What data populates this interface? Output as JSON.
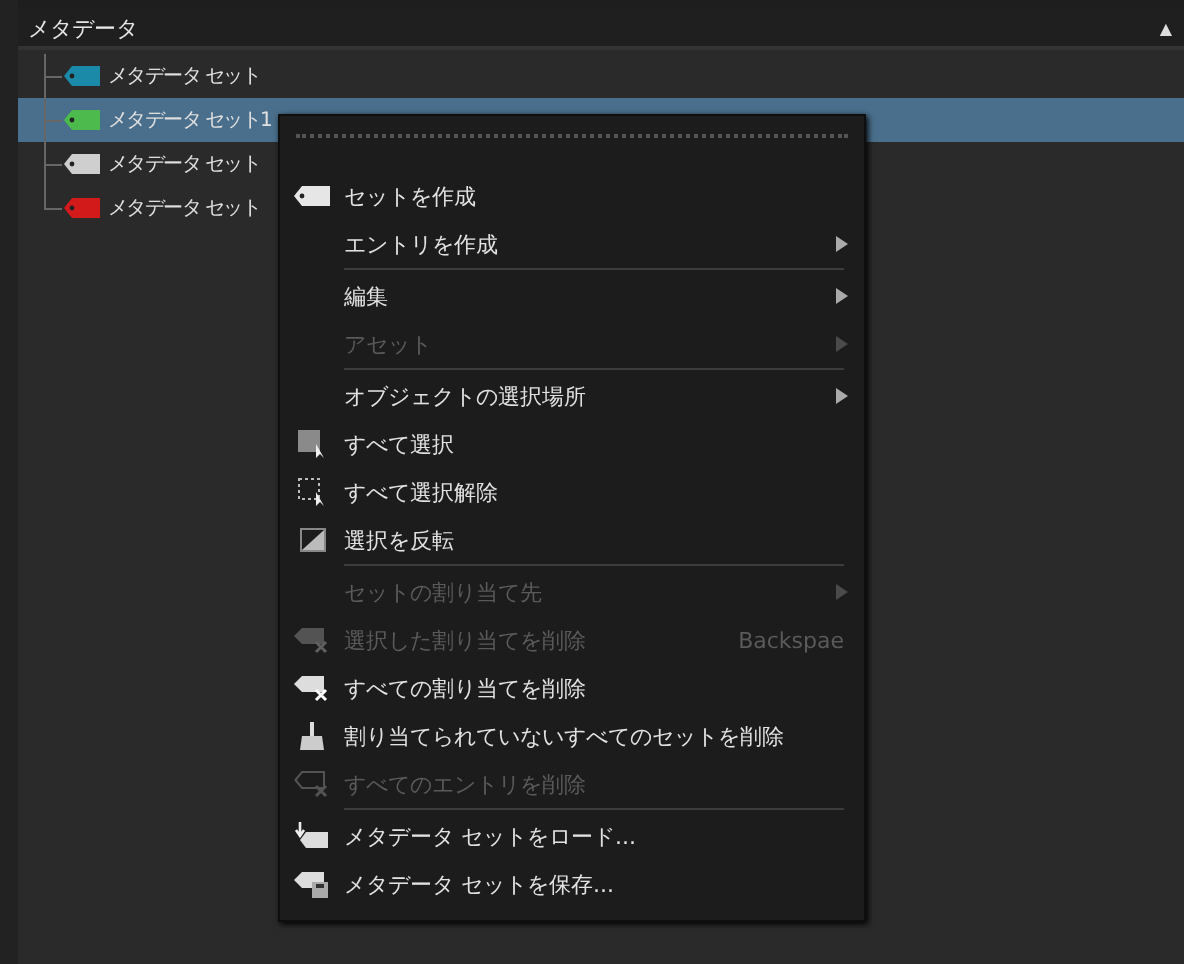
{
  "panel": {
    "title": "メタデータ",
    "collapse_glyph": "▲"
  },
  "tree": [
    {
      "label": "メタデータ セット",
      "color": "#1a8aa8",
      "selected": false
    },
    {
      "label": "メタデータ セット1",
      "color": "#4cba4c",
      "selected": true
    },
    {
      "label": "メタデータ セット",
      "color": "#cfcfcf",
      "selected": false
    },
    {
      "label": "メタデータ セット",
      "color": "#d21a1a",
      "selected": false
    }
  ],
  "menu": {
    "items": [
      {
        "kind": "item",
        "label": "セットを作成",
        "disabled": false,
        "submenu": false
      },
      {
        "kind": "item",
        "label": "エントリを作成",
        "disabled": false,
        "submenu": true
      },
      {
        "kind": "separator"
      },
      {
        "kind": "item",
        "label": "編集",
        "disabled": false,
        "submenu": true
      },
      {
        "kind": "item",
        "label": "アセット",
        "disabled": true,
        "submenu": true
      },
      {
        "kind": "separator"
      },
      {
        "kind": "item",
        "label": "オブジェクトの選択場所",
        "disabled": false,
        "submenu": true
      },
      {
        "kind": "item",
        "label": "すべて選択",
        "disabled": false,
        "submenu": false
      },
      {
        "kind": "item",
        "label": "すべて選択解除",
        "disabled": false,
        "submenu": false
      },
      {
        "kind": "item",
        "label": "選択を反転",
        "disabled": false,
        "submenu": false
      },
      {
        "kind": "separator"
      },
      {
        "kind": "item",
        "label": "セットの割り当て先",
        "disabled": true,
        "submenu": true
      },
      {
        "kind": "item",
        "label": "選択した割り当てを削除",
        "disabled": true,
        "submenu": false,
        "shortcut": "Backspae"
      },
      {
        "kind": "item",
        "label": "すべての割り当てを削除",
        "disabled": false,
        "submenu": false
      },
      {
        "kind": "item",
        "label": "割り当てられていないすべてのセットを削除",
        "disabled": false,
        "submenu": false
      },
      {
        "kind": "item",
        "label": "すべてのエントリを削除",
        "disabled": true,
        "submenu": false
      },
      {
        "kind": "separator"
      },
      {
        "kind": "item",
        "label": "メタデータ セットをロード...",
        "disabled": false,
        "submenu": false
      },
      {
        "kind": "item",
        "label": "メタデータ セットを保存...",
        "disabled": false,
        "submenu": false
      }
    ]
  }
}
